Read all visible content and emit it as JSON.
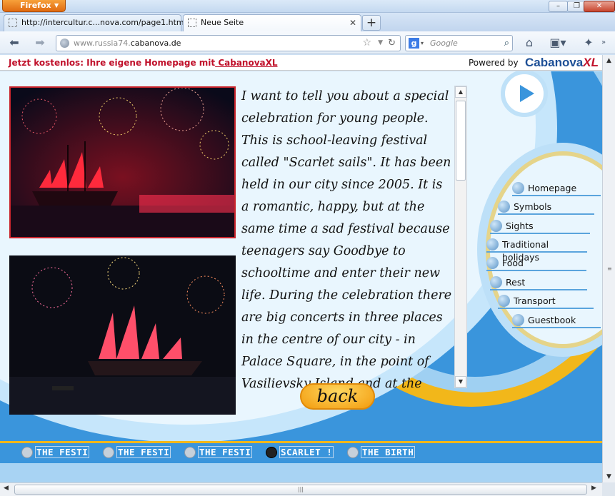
{
  "browser": {
    "app_button": "Firefox",
    "tabs": [
      {
        "label": "http://intercultur.c...nova.com/page1.html"
      },
      {
        "label": "Neue Seite"
      }
    ],
    "new_tab_label": "+",
    "url_host": "www.russia74.",
    "url_domain": "cabanova.de",
    "search_placeholder": "Google"
  },
  "banner": {
    "promo_text": "Jetzt kostenlos: Ihre eigene Homepage mit",
    "promo_link": " CabanovaXL",
    "powered_by": "Powered by",
    "brand": "Cabanova",
    "brand_suffix": "XL"
  },
  "content": {
    "paragraph": "I want to tell you about a special celebration for young people. This is school-leaving festival called \"Scarlet sails\". It has been held in our city since 2005. It is a romantic, happy, but at the same time a sad festival because teenagers say Goodbye to schooltime and enter their new life. During the celebration there are big concerts in three places in the centre of our city - in Palace Square, in the point of Vasilievsky Island and at the",
    "back_button": "back"
  },
  "nav": {
    "items": [
      {
        "label": "Homepage"
      },
      {
        "label": "Symbols"
      },
      {
        "label": "Sights"
      },
      {
        "label": "Traditional holidays"
      },
      {
        "label": "Food"
      },
      {
        "label": "Rest"
      },
      {
        "label": "Transport"
      },
      {
        "label": "Guestbook"
      }
    ]
  },
  "bottom_tabs": [
    {
      "label": "THE FESTI",
      "active": false
    },
    {
      "label": "THE FESTI",
      "active": false
    },
    {
      "label": "THE FESTI",
      "active": false
    },
    {
      "label": "SCARLET !",
      "active": true
    },
    {
      "label": "THE BIRTH",
      "active": false
    }
  ],
  "colors": {
    "page_blue": "#3a95dc",
    "accent_orange": "#f2b71a",
    "promo_red": "#c0102a",
    "brand_blue": "#1d4f96"
  }
}
